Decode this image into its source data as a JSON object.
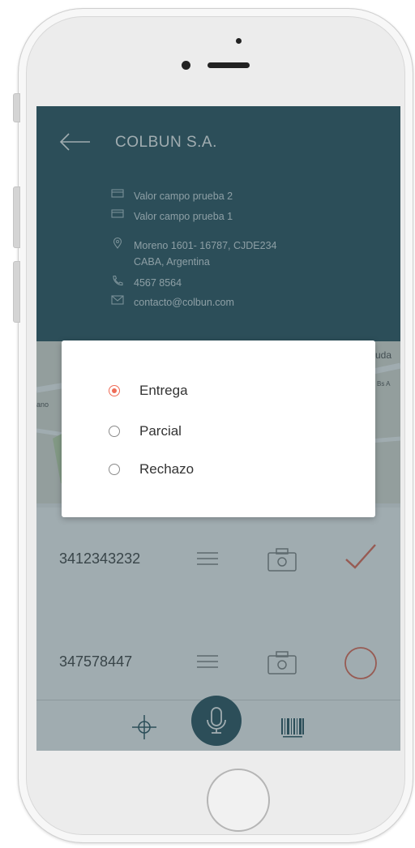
{
  "header": {
    "company": "COLBUN S.A.",
    "info": [
      {
        "icon": "card-icon",
        "text": "Valor campo prueba 2"
      },
      {
        "icon": "card-icon",
        "text": "Valor campo prueba 1"
      },
      {
        "icon": "location-pin-icon",
        "text": "Moreno 1601- 16787, CJDE234"
      },
      {
        "icon": "",
        "text": "CABA, Argentina"
      },
      {
        "icon": "phone-icon",
        "text": "4567 8564"
      },
      {
        "icon": "mail-icon",
        "text": "contacto@colbun.com"
      }
    ]
  },
  "map": {
    "labels": [
      "uda",
      "Bs A",
      "ano"
    ]
  },
  "dialog": {
    "options": [
      {
        "label": "Entrega",
        "selected": true
      },
      {
        "label": "Parcial",
        "selected": false
      },
      {
        "label": "Rechazo",
        "selected": false
      }
    ]
  },
  "rows": [
    {
      "code": "3412343232",
      "status": "check"
    },
    {
      "code": "347578447",
      "status": "circle"
    }
  ],
  "colors": {
    "primary": "#2c5461",
    "accent": "#ef6c57"
  },
  "bottom_bar": {
    "icons": [
      "target-icon",
      "mic-icon",
      "barcode-icon"
    ]
  }
}
